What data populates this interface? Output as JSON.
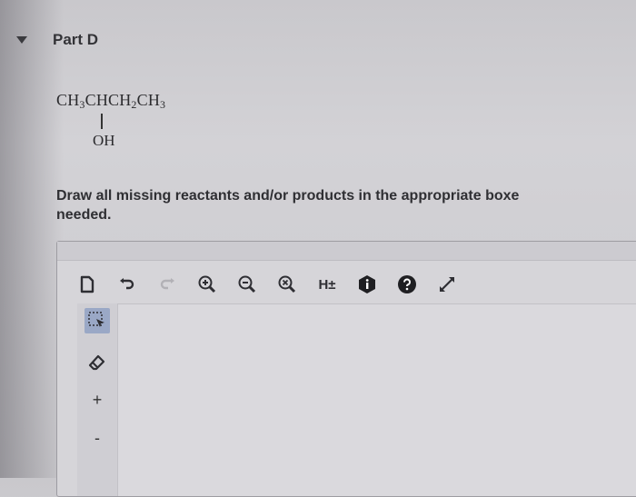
{
  "part": {
    "title": "Part D"
  },
  "formula": {
    "segments": [
      "CH",
      "3",
      "CHCH",
      "2",
      "CH",
      "3"
    ],
    "substituent": "OH"
  },
  "instructions": "Draw all missing reactants and/or products in the appropriate boxe",
  "instructions_line2": "needed.",
  "toolbar": {
    "hydrogen_label": "H±"
  },
  "side_toolbar": {
    "plus_label": "+",
    "minus_label": "-"
  }
}
